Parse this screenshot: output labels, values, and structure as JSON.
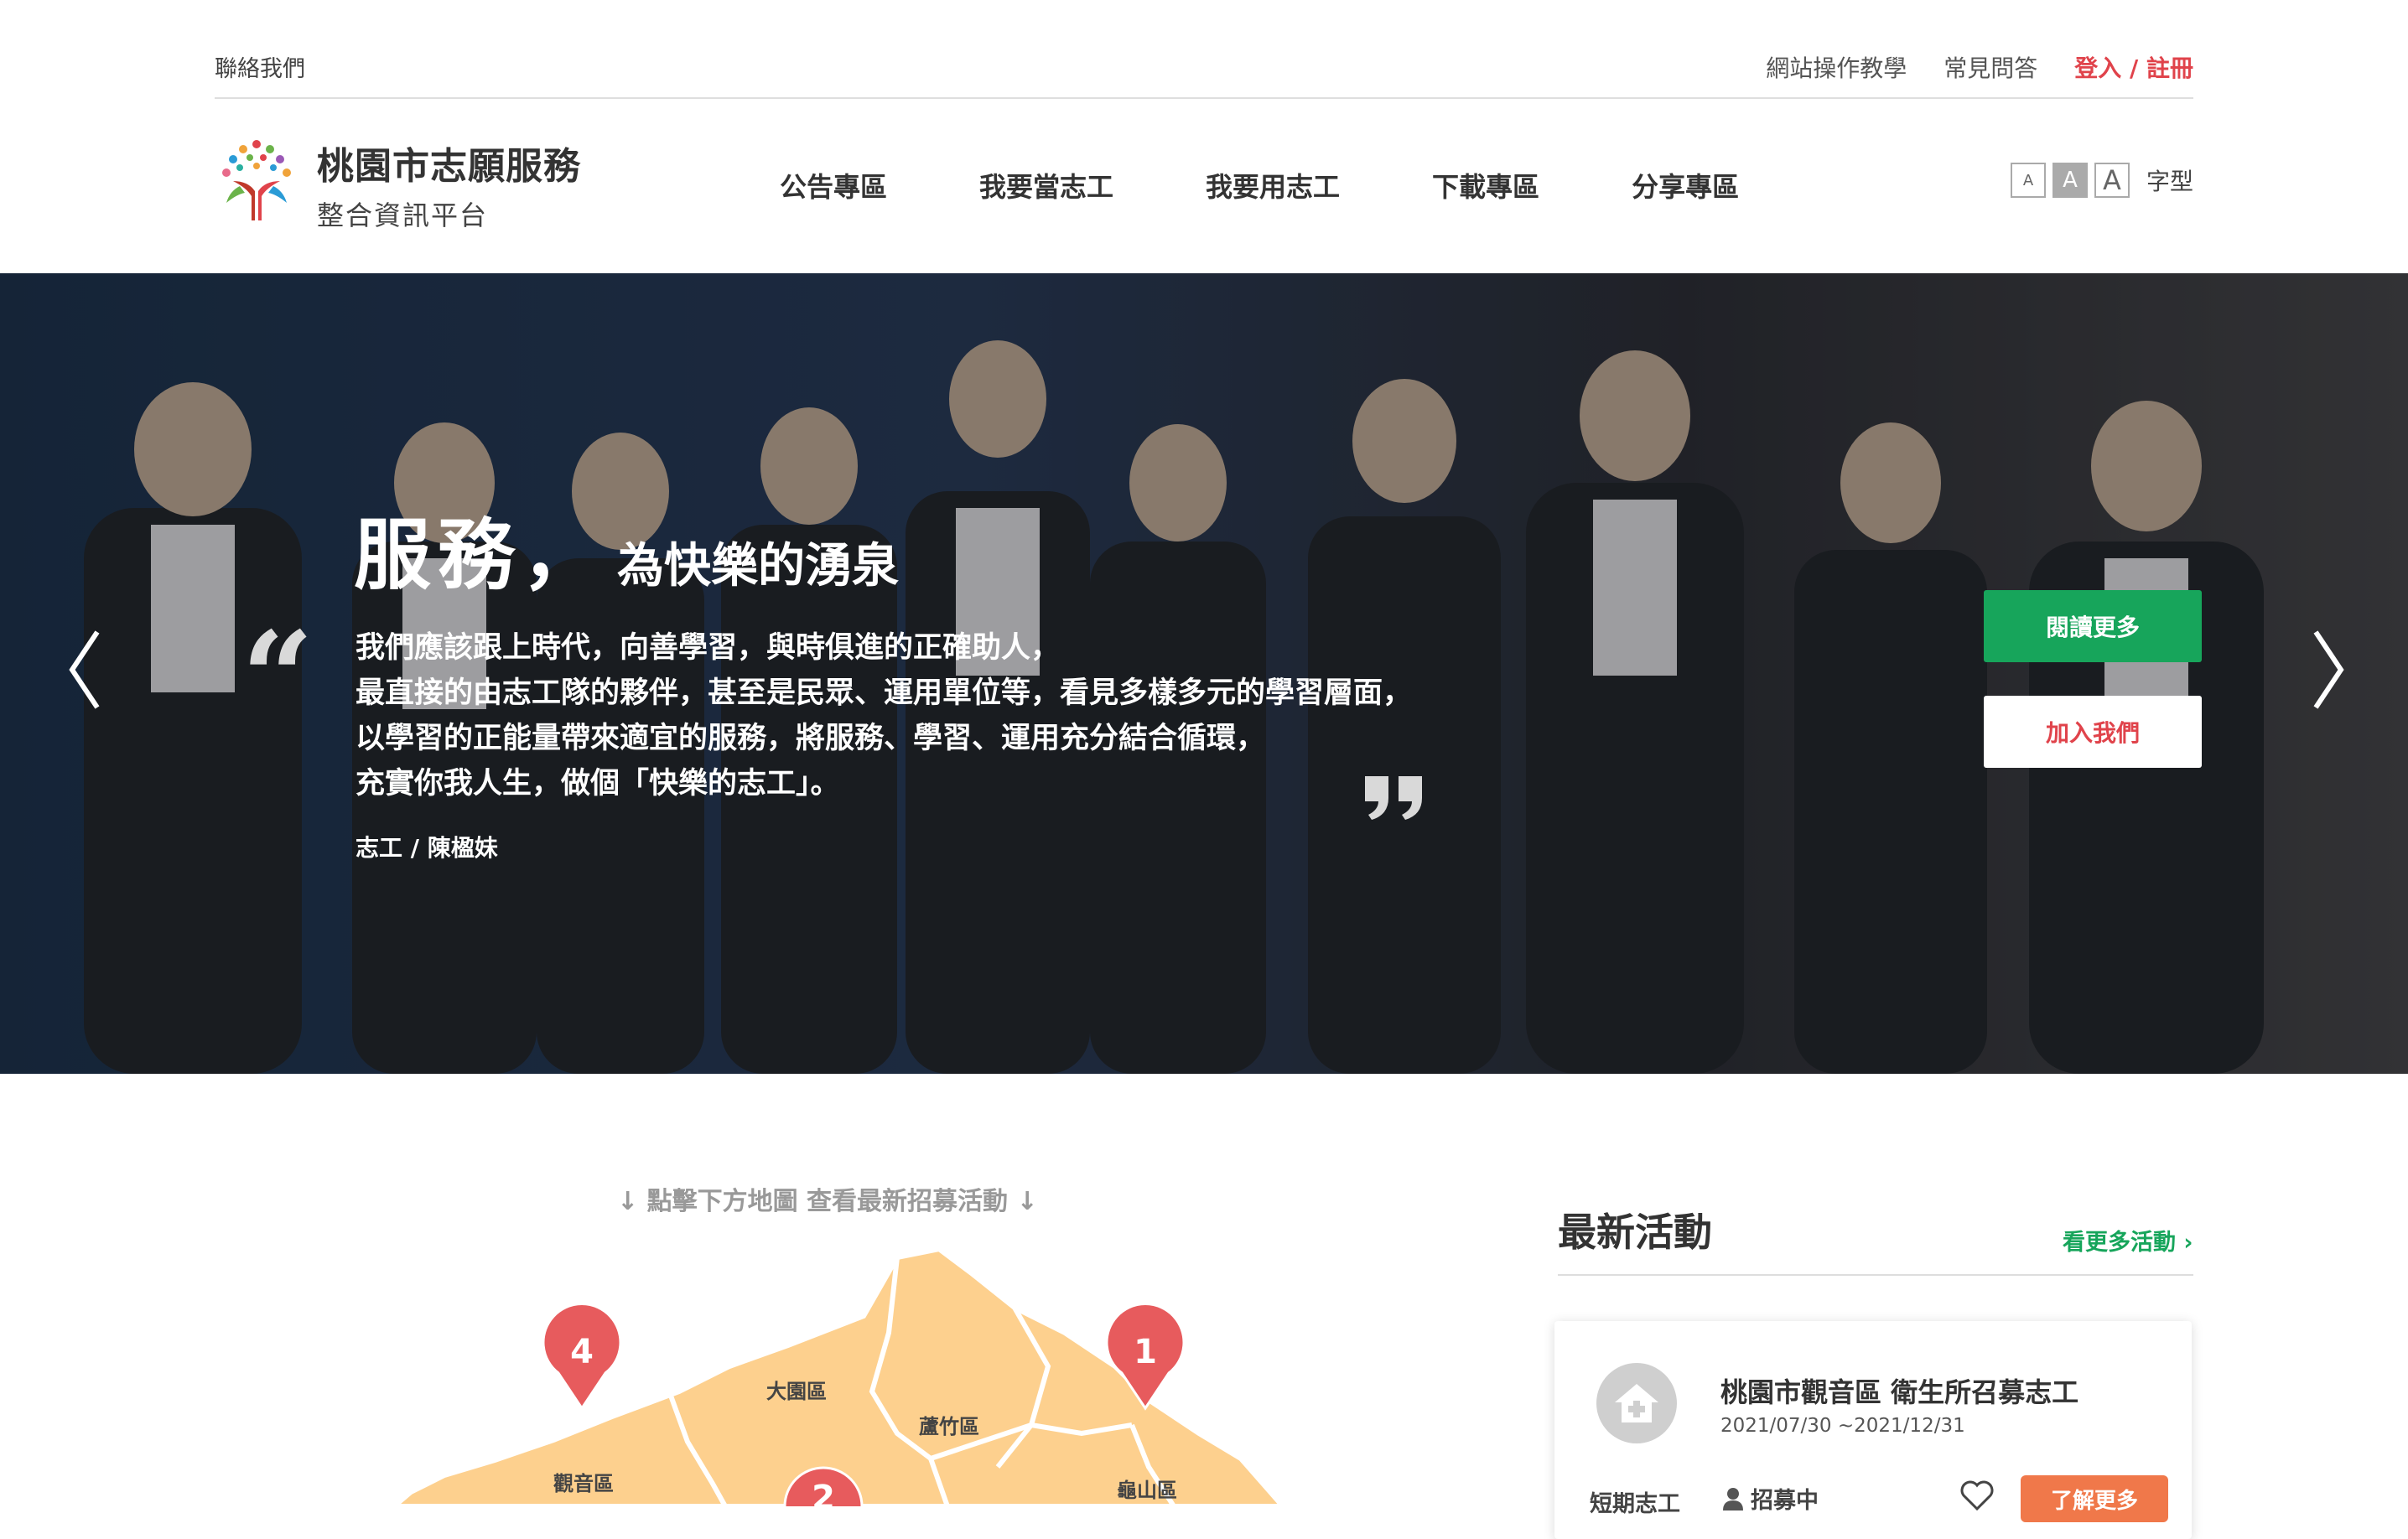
{
  "topbar": {
    "contact": "聯絡我們",
    "tutorial": "網站操作教學",
    "faq": "常見問答",
    "login": "登入 / 註冊"
  },
  "brand": {
    "title": "桃園市志願服務",
    "subtitle": "整合資訊平台"
  },
  "nav": {
    "items": [
      "公告專區",
      "我要當志工",
      "我要用志工",
      "下載專區",
      "分享專區"
    ]
  },
  "font_size": {
    "small": "A",
    "medium": "A",
    "large": "A",
    "label": "字型"
  },
  "hero": {
    "headline_big": "服務，",
    "headline_small": "為快樂的湧泉",
    "quote_lines": [
      "我們應該跟上時代，向善學習，與時俱進的正確助人，",
      "最直接的由志工隊的夥伴，甚至是民眾、運用單位等，看見多樣多元的學習層面，",
      "以學習的正能量帶來適宜的服務，將服務、學習、運用充分結合循環，",
      "充實你我人生，做個「快樂的志工」。"
    ],
    "author": "志工 / 陳楹妹",
    "read_more": "閱讀更多",
    "join_us": "加入我們"
  },
  "map": {
    "hint": "↓ 點擊下方地圖 查看最新招募活動 ↓",
    "districts": [
      "大園區",
      "蘆竹區",
      "觀音區",
      "龜山區"
    ],
    "pins": [
      "4",
      "1",
      "2"
    ]
  },
  "latest": {
    "title": "最新活動",
    "more": "看更多活動 ›",
    "card": {
      "title": "桃園市觀音區 衛生所召募志工",
      "date": "2021/07/30 ~2021/12/31",
      "type": "短期志工",
      "status": "招募中",
      "button": "了解更多"
    }
  },
  "colors": {
    "accent_red": "#e0434b",
    "green": "#17a55b",
    "orange": "#f0784a",
    "map_fill": "#fdd08e"
  }
}
